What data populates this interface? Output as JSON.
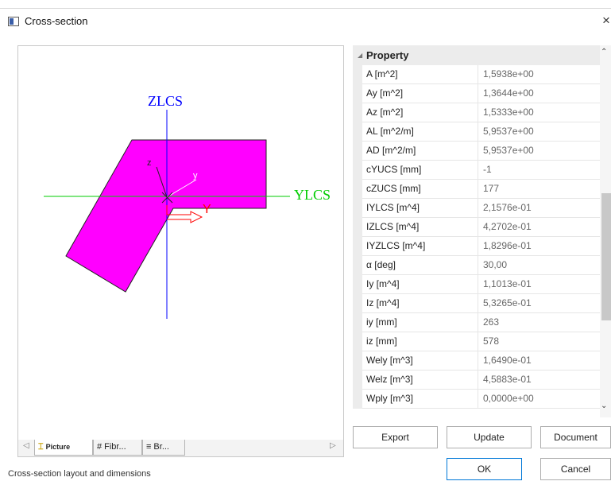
{
  "window": {
    "title": "Cross-section",
    "close_glyph": "×"
  },
  "drawing": {
    "axis_z_label": "ZLCS",
    "axis_y_label": "YLCS",
    "local_z": "z",
    "local_y": "y",
    "principal_y": "Y",
    "colors": {
      "section_fill": "#ff00ff",
      "z_axis": "#0000ff",
      "y_axis": "#00cc00",
      "principal": "#ff0000"
    }
  },
  "tabs": [
    {
      "label": "Picture",
      "icon": "section-icon"
    },
    {
      "label": "Fibr...",
      "icon": "grid-icon"
    },
    {
      "label": "Br...",
      "icon": "document-icon"
    }
  ],
  "grid": {
    "header": "Property",
    "rows": [
      {
        "name": "A [m^2]",
        "value": "1,5938e+00"
      },
      {
        "name": "Ay [m^2]",
        "value": "1,3644e+00"
      },
      {
        "name": "Az [m^2]",
        "value": "1,5333e+00"
      },
      {
        "name": "AL [m^2/m]",
        "value": "5,9537e+00"
      },
      {
        "name": "AD [m^2/m]",
        "value": "5,9537e+00"
      },
      {
        "name": "cYUCS [mm]",
        "value": "-1"
      },
      {
        "name": "cZUCS [mm]",
        "value": "177"
      },
      {
        "name": "IYLCS [m^4]",
        "value": "2,1576e-01"
      },
      {
        "name": "IZLCS [m^4]",
        "value": "4,2702e-01"
      },
      {
        "name": "IYZLCS [m^4]",
        "value": "1,8296e-01"
      },
      {
        "name": "α [deg]",
        "value": "30,00"
      },
      {
        "name": "Iy [m^4]",
        "value": "1,1013e-01"
      },
      {
        "name": "Iz [m^4]",
        "value": "5,3265e-01"
      },
      {
        "name": "iy [mm]",
        "value": "263"
      },
      {
        "name": "iz [mm]",
        "value": "578"
      },
      {
        "name": "Wely [m^3]",
        "value": "1,6490e-01"
      },
      {
        "name": "Welz [m^3]",
        "value": "4,5883e-01"
      },
      {
        "name": "Wply [m^3]",
        "value": "0,0000e+00"
      }
    ]
  },
  "buttons": {
    "export": "Export",
    "update": "Update",
    "document": "Document",
    "ok": "OK",
    "cancel": "Cancel"
  },
  "status": "Cross-section layout and dimensions"
}
